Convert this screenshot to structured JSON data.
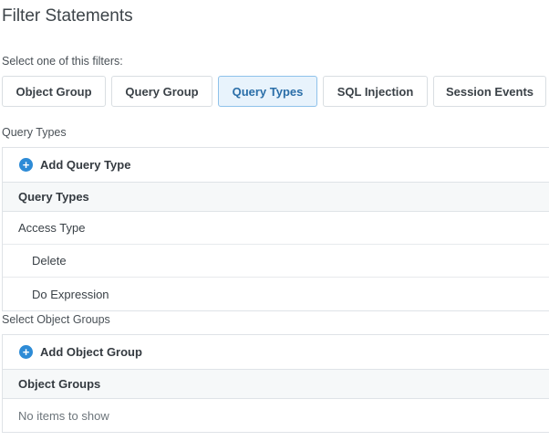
{
  "page": {
    "title": "Filter Statements"
  },
  "filters": {
    "label": "Select one of this filters:",
    "buttons": [
      {
        "label": "Object Group",
        "active": false
      },
      {
        "label": "Query Group",
        "active": false
      },
      {
        "label": "Query Types",
        "active": true
      },
      {
        "label": "SQL Injection",
        "active": false
      },
      {
        "label": "Session Events",
        "active": false
      }
    ]
  },
  "query_types": {
    "section_label": "Query Types",
    "add_label": "Add Query Type",
    "header": "Query Types",
    "rows": [
      {
        "label": "Access Type",
        "indent": false
      },
      {
        "label": "Delete",
        "indent": true
      },
      {
        "label": "Do Expression",
        "indent": true
      }
    ]
  },
  "object_groups": {
    "section_label": "Select Object Groups",
    "add_label": "Add Object Group",
    "header": "Object Groups",
    "empty_text": "No items to show"
  },
  "colors": {
    "accent": "#2d8bd6",
    "active_bg": "#e8f3fc",
    "active_border": "#8fc2ea",
    "active_text": "#2a6ea8"
  },
  "icons": {
    "add": "plus-circle-icon"
  }
}
